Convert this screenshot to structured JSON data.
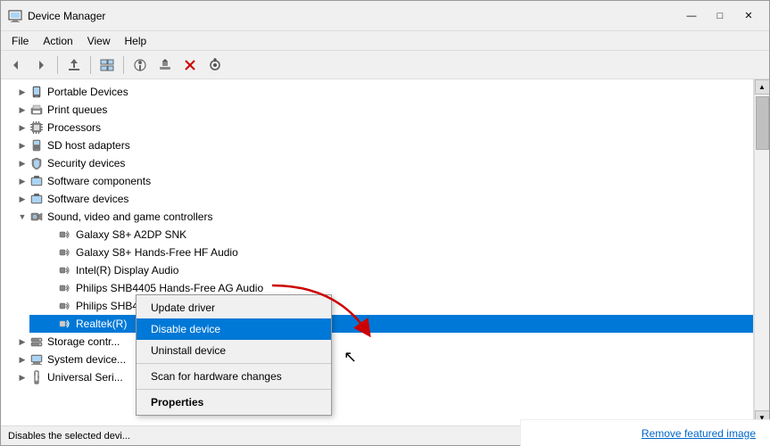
{
  "window": {
    "title": "Device Manager",
    "icon": "device-manager-icon",
    "controls": {
      "minimize": "—",
      "maximize": "□",
      "close": "✕"
    }
  },
  "menubar": {
    "items": [
      {
        "id": "file",
        "label": "File"
      },
      {
        "id": "action",
        "label": "Action"
      },
      {
        "id": "view",
        "label": "View"
      },
      {
        "id": "help",
        "label": "Help"
      }
    ]
  },
  "toolbar": {
    "buttons": [
      {
        "id": "back",
        "icon": "◀",
        "title": "Back"
      },
      {
        "id": "forward",
        "icon": "▶",
        "title": "Forward"
      },
      {
        "id": "up",
        "icon": "⬆",
        "title": "Up"
      },
      {
        "id": "show-hide",
        "icon": "⊞",
        "title": "Show/Hide"
      },
      {
        "id": "properties",
        "icon": "ℹ",
        "title": "Properties"
      },
      {
        "id": "update-driver",
        "icon": "⬛",
        "title": "Update Driver"
      },
      {
        "id": "uninstall",
        "icon": "✕",
        "title": "Uninstall"
      },
      {
        "id": "scan",
        "icon": "⊙",
        "title": "Scan for hardware changes"
      }
    ]
  },
  "tree": {
    "items": [
      {
        "id": "portable-devices",
        "label": "Portable Devices",
        "indent": 1,
        "expanded": false,
        "icon": "portable"
      },
      {
        "id": "print-queues",
        "label": "Print queues",
        "indent": 1,
        "expanded": false,
        "icon": "print"
      },
      {
        "id": "processors",
        "label": "Processors",
        "indent": 1,
        "expanded": false,
        "icon": "processor"
      },
      {
        "id": "sd-host-adapters",
        "label": "SD host adapters",
        "indent": 1,
        "expanded": false,
        "icon": "sd"
      },
      {
        "id": "security-devices",
        "label": "Security devices",
        "indent": 1,
        "expanded": false,
        "icon": "security"
      },
      {
        "id": "software-components",
        "label": "Software components",
        "indent": 1,
        "expanded": false,
        "icon": "software"
      },
      {
        "id": "software-devices",
        "label": "Software devices",
        "indent": 1,
        "expanded": false,
        "icon": "software"
      },
      {
        "id": "sound-video",
        "label": "Sound, video and game controllers",
        "indent": 1,
        "expanded": true,
        "icon": "sound"
      },
      {
        "id": "galaxy-s8-a2dp",
        "label": "Galaxy S8+ A2DP SNK",
        "indent": 2,
        "icon": "audio"
      },
      {
        "id": "galaxy-s8-hf",
        "label": "Galaxy S8+ Hands-Free HF Audio",
        "indent": 2,
        "icon": "audio"
      },
      {
        "id": "intel-display-audio",
        "label": "Intel(R) Display Audio",
        "indent": 2,
        "icon": "audio"
      },
      {
        "id": "philips-shb4405-hf",
        "label": "Philips SHB4405 Hands-Free AG Audio",
        "indent": 2,
        "icon": "audio"
      },
      {
        "id": "philips-shb4405-stereo",
        "label": "Philips SHB4405 Stereo",
        "indent": 2,
        "icon": "audio"
      },
      {
        "id": "realtek",
        "label": "Realtek(R)",
        "indent": 2,
        "icon": "audio",
        "selected": true
      },
      {
        "id": "storage-controllers",
        "label": "Storage contr...",
        "indent": 1,
        "expanded": false,
        "icon": "storage"
      },
      {
        "id": "system-devices",
        "label": "System device...",
        "indent": 1,
        "expanded": false,
        "icon": "system"
      },
      {
        "id": "universal-serial",
        "label": "Universal Seri...",
        "indent": 1,
        "expanded": false,
        "icon": "usb"
      }
    ]
  },
  "context_menu": {
    "items": [
      {
        "id": "update-driver",
        "label": "Update driver"
      },
      {
        "id": "disable-device",
        "label": "Disable device",
        "highlighted": true
      },
      {
        "id": "uninstall-device",
        "label": "Uninstall device"
      },
      {
        "separator": true
      },
      {
        "id": "scan-hardware",
        "label": "Scan for hardware changes"
      },
      {
        "separator": true
      },
      {
        "id": "properties",
        "label": "Properties",
        "bold": true
      }
    ]
  },
  "status_bar": {
    "text": "Disables the selected devi..."
  },
  "featured_image": {
    "remove_label": "Remove featured image"
  }
}
